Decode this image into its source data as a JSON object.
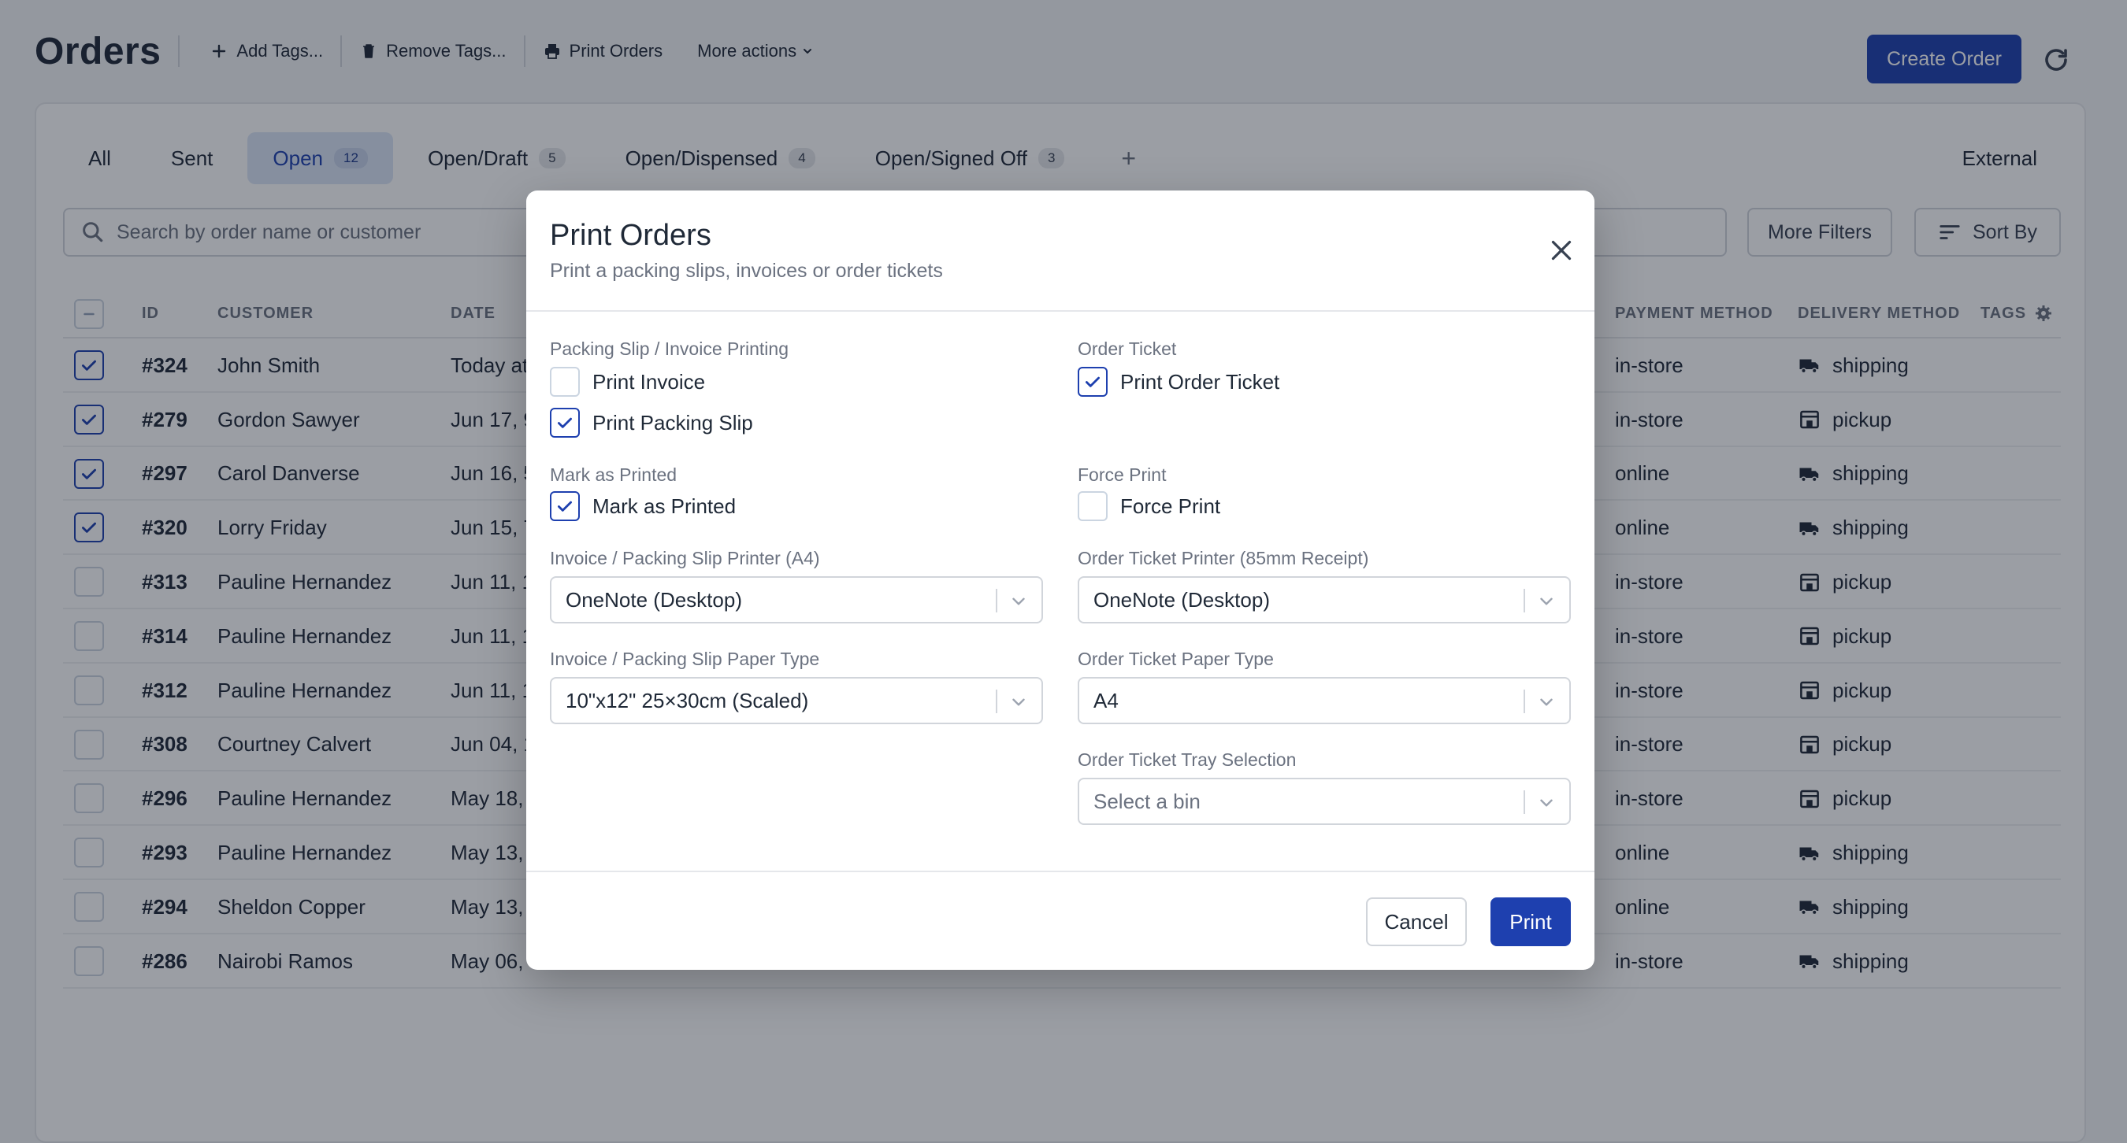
{
  "header": {
    "title": "Orders",
    "add_tags": "Add Tags...",
    "remove_tags": "Remove Tags...",
    "print_orders": "Print Orders",
    "more_actions": "More actions",
    "create_order": "Create Order"
  },
  "tabs": [
    {
      "label": "All",
      "count": ""
    },
    {
      "label": "Sent",
      "count": ""
    },
    {
      "label": "Open",
      "count": "12"
    },
    {
      "label": "Open/Draft",
      "count": "5"
    },
    {
      "label": "Open/Dispensed",
      "count": "4"
    },
    {
      "label": "Open/Signed Off",
      "count": "3"
    }
  ],
  "external_tab": "External",
  "search": {
    "placeholder": "Search by order name or customer"
  },
  "filters": {
    "more_filters": "More Filters",
    "sort_by": "Sort By"
  },
  "columns": {
    "id": "ID",
    "customer": "CUSTOMER",
    "date": "DATE",
    "payment_method": "PAYMENT METHOD",
    "delivery_method": "DELIVERY METHOD",
    "tags": "TAGS"
  },
  "rows": [
    {
      "id": "#324",
      "customer": "John Smith",
      "date": "Today at",
      "payment": "in-store",
      "delivery": "shipping",
      "checked": true
    },
    {
      "id": "#279",
      "customer": "Gordon Sawyer",
      "date": "Jun 17, 9",
      "payment": "in-store",
      "delivery": "pickup",
      "checked": true
    },
    {
      "id": "#297",
      "customer": "Carol Danverse",
      "date": "Jun 16, 5",
      "payment": "online",
      "delivery": "shipping",
      "checked": true
    },
    {
      "id": "#320",
      "customer": "Lorry Friday",
      "date": "Jun 15, 7",
      "payment": "online",
      "delivery": "shipping",
      "checked": true
    },
    {
      "id": "#313",
      "customer": "Pauline Hernandez",
      "date": "Jun 11, 1",
      "payment": "in-store",
      "delivery": "pickup",
      "checked": false
    },
    {
      "id": "#314",
      "customer": "Pauline Hernandez",
      "date": "Jun 11, 1",
      "payment": "in-store",
      "delivery": "pickup",
      "checked": false
    },
    {
      "id": "#312",
      "customer": "Pauline Hernandez",
      "date": "Jun 11, 1",
      "payment": "in-store",
      "delivery": "pickup",
      "checked": false
    },
    {
      "id": "#308",
      "customer": "Courtney Calvert",
      "date": "Jun 04, 1",
      "payment": "in-store",
      "delivery": "pickup",
      "checked": false
    },
    {
      "id": "#296",
      "customer": "Pauline Hernandez",
      "date": "May 18,",
      "payment": "in-store",
      "delivery": "pickup",
      "checked": false
    },
    {
      "id": "#293",
      "customer": "Pauline Hernandez",
      "date": "May 13,",
      "payment": "online",
      "delivery": "shipping",
      "checked": false
    },
    {
      "id": "#294",
      "customer": "Sheldon Copper",
      "date": "May 13,",
      "payment": "online",
      "delivery": "shipping",
      "checked": false
    },
    {
      "id": "#286",
      "customer": "Nairobi Ramos",
      "date": "May 06,",
      "payment": "in-store",
      "delivery": "shipping",
      "checked": false
    }
  ],
  "modal": {
    "title": "Print Orders",
    "subtitle": "Print a packing slips, invoices or order tickets",
    "packing_section": "Packing Slip / Invoice Printing",
    "print_invoice": "Print Invoice",
    "print_invoice_checked": false,
    "print_packing_slip": "Print Packing Slip",
    "print_packing_slip_checked": true,
    "order_ticket_section": "Order Ticket",
    "print_order_ticket": "Print Order Ticket",
    "print_order_ticket_checked": true,
    "mark_printed_section": "Mark as Printed",
    "mark_printed": "Mark as Printed",
    "mark_printed_checked": true,
    "force_print_section": "Force Print",
    "force_print": "Force Print",
    "force_print_checked": false,
    "invoice_printer_label": "Invoice / Packing Slip Printer (A4)",
    "invoice_printer_value": "OneNote (Desktop)",
    "ticket_printer_label": "Order Ticket Printer (85mm Receipt)",
    "ticket_printer_value": "OneNote (Desktop)",
    "invoice_paper_label": "Invoice / Packing Slip Paper Type",
    "invoice_paper_value": "10\"x12\" 25×30cm (Scaled)",
    "ticket_paper_label": "Order Ticket Paper Type",
    "ticket_paper_value": "A4",
    "tray_label": "Order Ticket Tray Selection",
    "tray_placeholder": "Select a bin",
    "cancel": "Cancel",
    "print": "Print"
  },
  "colors": {
    "primary": "#1e40af",
    "overlay": "#111827",
    "tab_active_bg": "#dbe5f6"
  },
  "icons": {
    "add_tags": "plus-icon",
    "remove_tags": "trash-icon",
    "print_orders": "printer-icon",
    "more_actions": "chevron-down-icon",
    "refresh": "refresh-icon",
    "search": "search-icon",
    "sort": "sort-lines-icon",
    "tags_settings": "gear-icon",
    "shipping": "truck-icon",
    "pickup": "store-icon",
    "close": "close-icon"
  }
}
